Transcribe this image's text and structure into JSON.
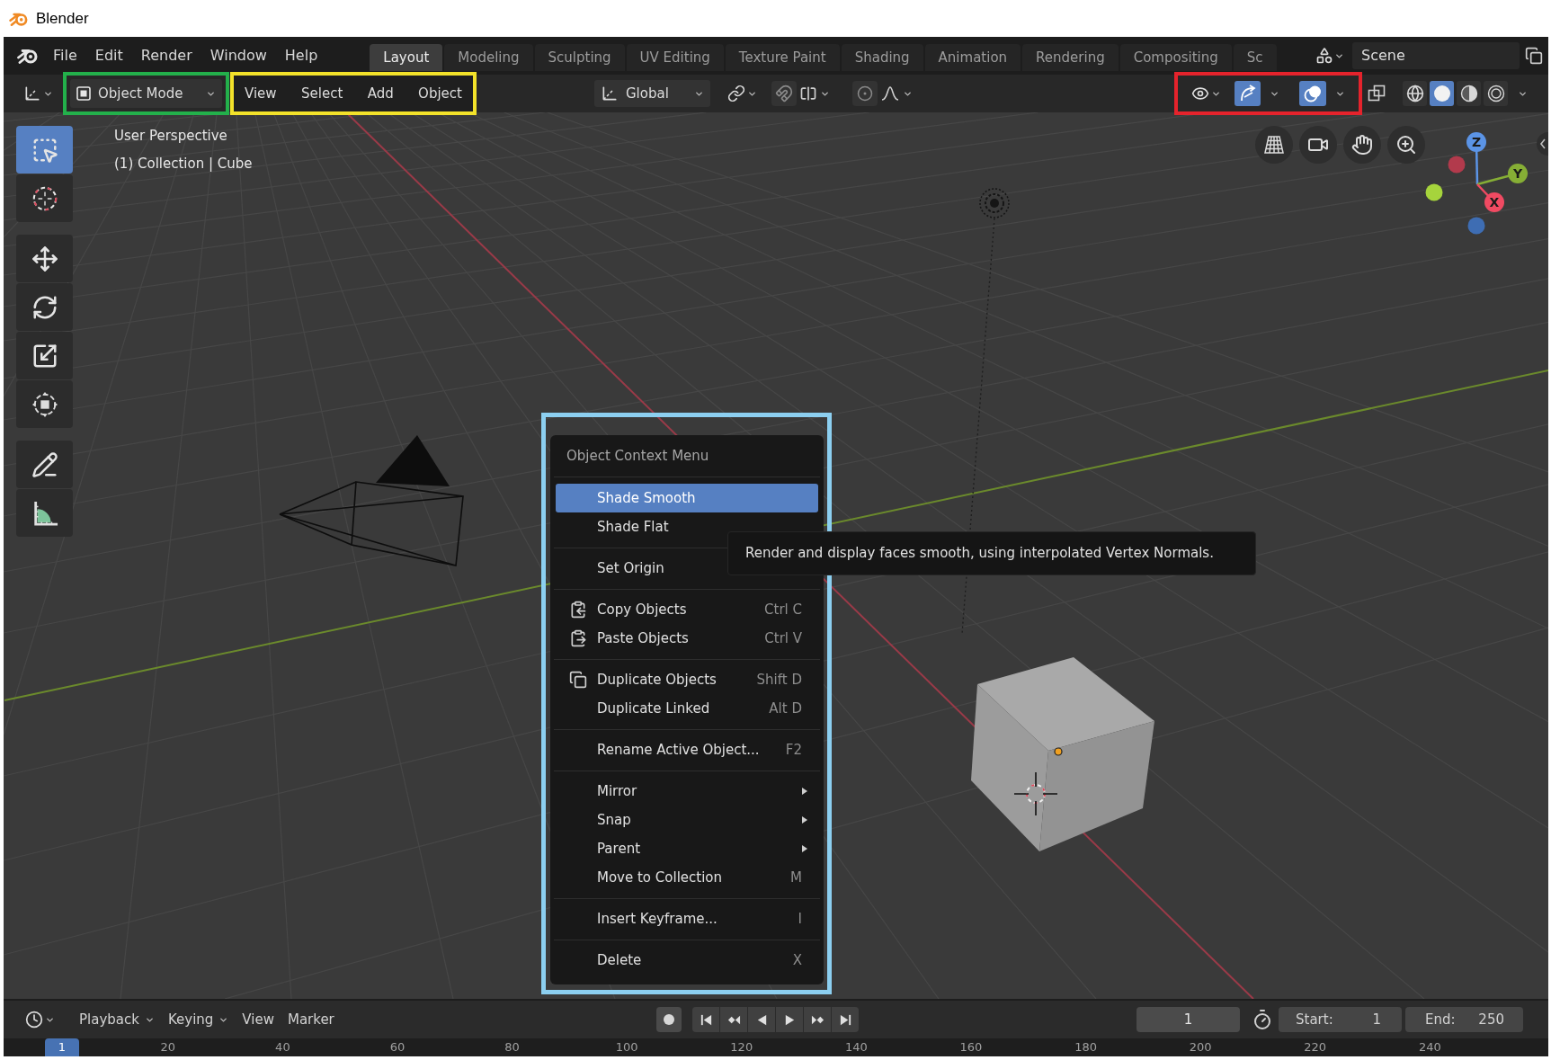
{
  "window": {
    "title": "Blender"
  },
  "top_bar": {
    "menus": [
      "File",
      "Edit",
      "Render",
      "Window",
      "Help"
    ],
    "workspace_tabs": [
      {
        "label": "Layout",
        "selected": true
      },
      {
        "label": "Modeling",
        "selected": false
      },
      {
        "label": "Sculpting",
        "selected": false
      },
      {
        "label": "UV Editing",
        "selected": false
      },
      {
        "label": "Texture Paint",
        "selected": false
      },
      {
        "label": "Shading",
        "selected": false
      },
      {
        "label": "Animation",
        "selected": false
      },
      {
        "label": "Rendering",
        "selected": false
      },
      {
        "label": "Compositing",
        "selected": false
      },
      {
        "label": "Sc",
        "selected": false
      }
    ],
    "scene_field": {
      "value": "Scene"
    }
  },
  "header": {
    "mode_dropdown": {
      "label": "Object Mode"
    },
    "menus": [
      "View",
      "Select",
      "Add",
      "Object"
    ],
    "orientation_dropdown": {
      "label": "Global"
    },
    "snap": {
      "on": false
    },
    "proportional_editing": {
      "on": false
    },
    "gizmos": {
      "on": true
    },
    "overlays": {
      "on": true
    },
    "shading_modes": [
      {
        "selected": false
      },
      {
        "selected": true
      },
      {
        "selected": false
      },
      {
        "selected": false
      }
    ]
  },
  "viewport": {
    "info_lines": [
      "User Perspective",
      "(1) Collection | Cube"
    ],
    "tool_groups": [
      {
        "tools": [
          {
            "selected": true
          },
          {
            "selected": false
          }
        ]
      },
      {
        "tools": [
          {
            "selected": false
          },
          {
            "selected": false
          },
          {
            "selected": false
          },
          {
            "selected": false
          }
        ]
      },
      {
        "tools": [
          {
            "selected": false
          },
          {
            "selected": false
          }
        ]
      }
    ],
    "axis_gizmo": [
      {
        "kind": "positive",
        "label": "Z",
        "color": "#5b94e6"
      },
      {
        "kind": "positive",
        "label": "Y",
        "color": "#86ae35"
      },
      {
        "kind": "positive",
        "label": "X",
        "color": "#f04a62"
      },
      {
        "kind": "negative",
        "color": "#b23a4c"
      },
      {
        "kind": "negative",
        "color": "#a6d43c"
      },
      {
        "kind": "negative",
        "color": "#3e6db3"
      }
    ]
  },
  "context_menu": {
    "title": "Object Context Menu",
    "groups": [
      {
        "items": [
          {
            "label": "Shade Smooth",
            "selected": true,
            "submenu": false
          },
          {
            "label": "Shade Flat",
            "selected": false,
            "submenu": false
          }
        ]
      },
      {
        "items": [
          {
            "label": "Set Origin",
            "selected": false,
            "submenu": false
          }
        ]
      },
      {
        "items": [
          {
            "label": "Copy Objects",
            "shortcut": "Ctrl C",
            "selected": false,
            "submenu": false
          },
          {
            "label": "Paste Objects",
            "shortcut": "Ctrl V",
            "selected": false,
            "submenu": false
          }
        ]
      },
      {
        "items": [
          {
            "label": "Duplicate Objects",
            "shortcut": "Shift D",
            "selected": false,
            "submenu": false
          },
          {
            "label": "Duplicate Linked",
            "shortcut": "Alt D",
            "selected": false,
            "submenu": false
          }
        ]
      },
      {
        "items": [
          {
            "label": "Rename Active Object...",
            "shortcut": "F2",
            "selected": false,
            "submenu": false
          }
        ]
      },
      {
        "items": [
          {
            "label": "Mirror",
            "selected": false,
            "submenu": true
          },
          {
            "label": "Snap",
            "selected": false,
            "submenu": true
          },
          {
            "label": "Parent",
            "selected": false,
            "submenu": true
          },
          {
            "label": "Move to Collection",
            "shortcut": "M",
            "selected": false,
            "submenu": false
          }
        ]
      },
      {
        "items": [
          {
            "label": "Insert Keyframe...",
            "shortcut": "I",
            "selected": false,
            "submenu": false
          }
        ]
      },
      {
        "items": [
          {
            "label": "Delete",
            "shortcut": "X",
            "selected": false,
            "submenu": false
          }
        ]
      }
    ]
  },
  "tooltip": {
    "text": "Render and display faces smooth, using interpolated Vertex Normals."
  },
  "timeline": {
    "menus": [
      {
        "label": "Playback",
        "dropdown": true
      },
      {
        "label": "Keying",
        "dropdown": true
      },
      {
        "label": "View",
        "dropdown": false
      },
      {
        "label": "Marker",
        "dropdown": false
      }
    ],
    "current_frame": "1",
    "start": {
      "label": "Start:",
      "value": "1"
    },
    "end": {
      "label": "End:",
      "value": "250"
    },
    "ruler": {
      "playhead": "1",
      "labels": [
        "20",
        "40",
        "60",
        "80",
        "100",
        "120",
        "140",
        "160",
        "180",
        "200",
        "220",
        "240"
      ]
    }
  }
}
